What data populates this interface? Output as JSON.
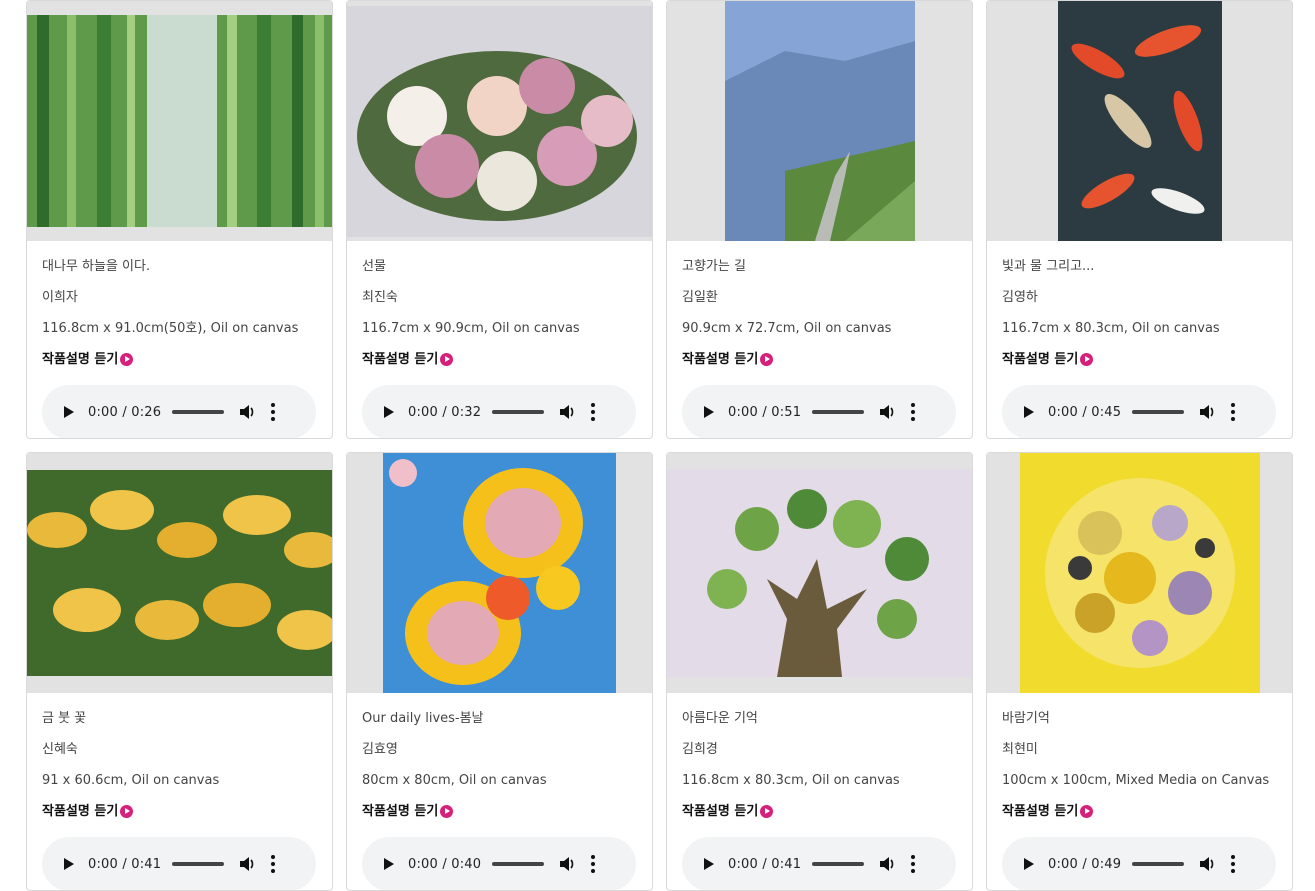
{
  "listen_label": "작품설명 듣기",
  "artworks": [
    {
      "title": "대나무 하늘을 이다.",
      "artist": "이희자",
      "spec": "116.8cm x 91.0cm(50호), Oil on canvas",
      "current": "0:00",
      "duration": "0:26"
    },
    {
      "title": "선물",
      "artist": "최진숙",
      "spec": "116.7cm x 90.9cm, Oil on canvas",
      "current": "0:00",
      "duration": "0:32"
    },
    {
      "title": "고향가는 길",
      "artist": "김일환",
      "spec": "90.9cm x 72.7cm, Oil on canvas",
      "current": "0:00",
      "duration": "0:51"
    },
    {
      "title": "빛과 물 그리고...",
      "artist": "김영하",
      "spec": "116.7cm x 80.3cm, Oil on canvas",
      "current": "0:00",
      "duration": "0:45"
    },
    {
      "title": "금 붓 꽃",
      "artist": "신혜숙",
      "spec": "91 x 60.6cm, Oil on canvas",
      "current": "0:00",
      "duration": "0:41"
    },
    {
      "title": "Our daily lives-봄날",
      "artist": "김효영",
      "spec": "80cm x 80cm, Oil on canvas",
      "current": "0:00",
      "duration": "0:40"
    },
    {
      "title": "아름다운 기억",
      "artist": "김희경",
      "spec": "116.8cm x 80.3cm, Oil on canvas",
      "current": "0:00",
      "duration": "0:41"
    },
    {
      "title": "바람기억",
      "artist": "최현미",
      "spec": "100cm x 100cm, Mixed Media on Canvas",
      "current": "0:00",
      "duration": "0:49"
    }
  ]
}
